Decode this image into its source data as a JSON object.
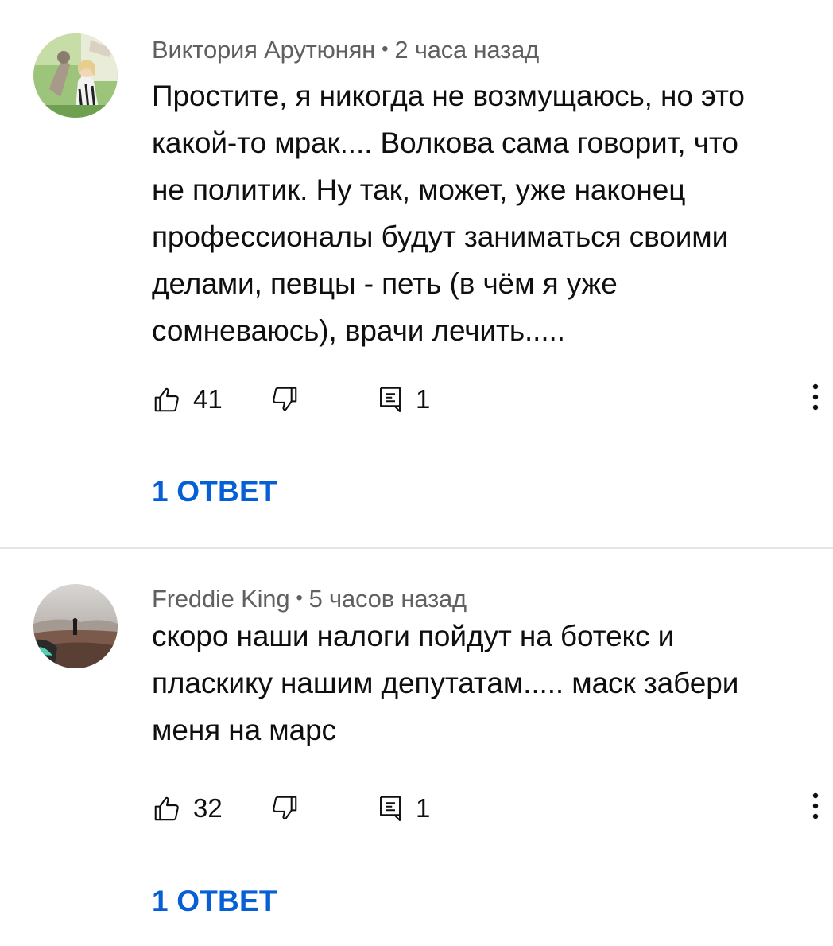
{
  "comments": [
    {
      "author": "Виктория Арутюнян",
      "time": "2 часа назад",
      "text": "Простите, я никогда не возмущаюсь, но это\nкакой-то мрак.... Волкова сама говорит, что\nне политик. Ну так, может, уже наконец\nпрофессионалы будут заниматься своими\nделами, певцы - петь (в чём я уже\nсомневаюсь), врачи лечить.....",
      "likes": "41",
      "reply_count": "1",
      "replies_label": "1 ОТВЕТ"
    },
    {
      "author": "Freddie King",
      "time": "5 часов назад",
      "text": "скоро наши налоги пойдут на ботекс и\nпласкику нашим депутатам..... маск забери\nменя на марс",
      "likes": "32",
      "reply_count": "1",
      "replies_label": "1 ОТВЕТ"
    }
  ],
  "separator": "•",
  "icons": {
    "like": "thumb-up-icon",
    "dislike": "thumb-down-icon",
    "reply": "reply-comment-icon",
    "more": "more-vertical-icon"
  },
  "colors": {
    "meta": "#606060",
    "text": "#0f0f0f",
    "link": "#065fd4",
    "divider": "#e5e5e5"
  }
}
